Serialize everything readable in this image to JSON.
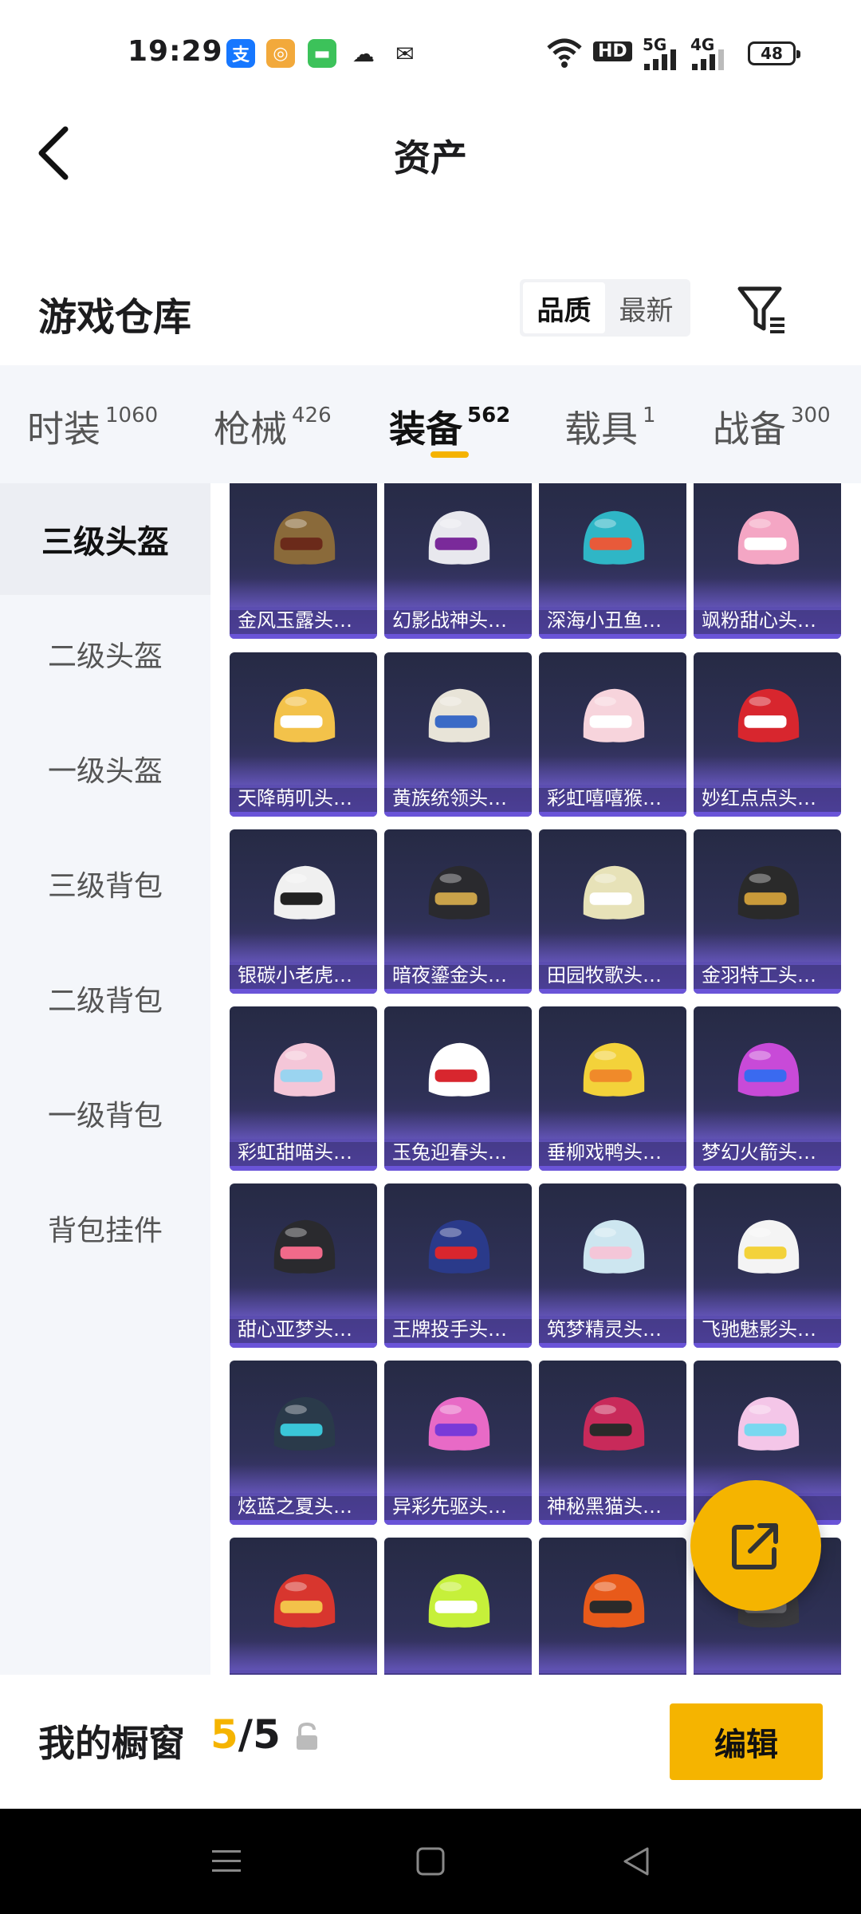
{
  "status_bar": {
    "time": "19:29",
    "battery": "48",
    "network_labels": [
      "HD",
      "5G",
      "4G"
    ]
  },
  "header": {
    "title": "资产"
  },
  "section": {
    "title": "游戏仓库",
    "sort_options": [
      "品质",
      "最新"
    ],
    "active_sort": "品质"
  },
  "tabs": [
    {
      "label": "时装",
      "count": "1060"
    },
    {
      "label": "枪械",
      "count": "426"
    },
    {
      "label": "装备",
      "count": "562"
    },
    {
      "label": "载具",
      "count": "1"
    },
    {
      "label": "战备",
      "count": "300"
    }
  ],
  "active_tab": "装备",
  "sidebar": {
    "items": [
      "三级头盔",
      "二级头盔",
      "一级头盔",
      "三级背包",
      "二级背包",
      "一级背包",
      "背包挂件"
    ],
    "active": "三级头盔"
  },
  "items": [
    {
      "label": "金风玉露头盔...",
      "colors": [
        "#8a6a3a",
        "#6b2a1a"
      ]
    },
    {
      "label": "幻影战神头盔...",
      "colors": [
        "#e8e8ee",
        "#7a2a9a"
      ]
    },
    {
      "label": "深海小丑鱼头...",
      "colors": [
        "#2fb6c6",
        "#e85a3a"
      ]
    },
    {
      "label": "飒粉甜心头盔...",
      "colors": [
        "#f4a6c4",
        "#ffffff"
      ]
    },
    {
      "label": "天降萌叽头盔...",
      "colors": [
        "#f3c24a",
        "#ffffff"
      ]
    },
    {
      "label": "黄族统领头盔...",
      "colors": [
        "#e8e4d8",
        "#3a6ac6"
      ]
    },
    {
      "label": "彩虹嘻嘻猴头...",
      "colors": [
        "#f7d4dc",
        "#ffffff"
      ]
    },
    {
      "label": "妙红点点头盔...",
      "colors": [
        "#d8262e",
        "#ffffff"
      ]
    },
    {
      "label": "银碳小老虎头...",
      "colors": [
        "#f0f0f0",
        "#222222"
      ]
    },
    {
      "label": "暗夜鎏金头盔...",
      "colors": [
        "#2a2a2e",
        "#c9a24a"
      ]
    },
    {
      "label": "田园牧歌头盔...",
      "colors": [
        "#e7e2b8",
        "#ffffff"
      ]
    },
    {
      "label": "金羽特工头盔...",
      "colors": [
        "#2a2a2a",
        "#c99a3a"
      ]
    },
    {
      "label": "彩虹甜喵头盔...",
      "colors": [
        "#f4c6d8",
        "#9ad4f0"
      ]
    },
    {
      "label": "玉兔迎春头盔...",
      "colors": [
        "#ffffff",
        "#d8262e"
      ]
    },
    {
      "label": "垂柳戏鸭头盔...",
      "colors": [
        "#f3d23a",
        "#f08a2a"
      ]
    },
    {
      "label": "梦幻火箭头盔...",
      "colors": [
        "#c84ad8",
        "#3a6af0"
      ]
    },
    {
      "label": "甜心亚梦头盔...",
      "colors": [
        "#2a2a2e",
        "#f06a8a"
      ]
    },
    {
      "label": "王牌投手头盔...",
      "colors": [
        "#2a3a8a",
        "#d8262e"
      ]
    },
    {
      "label": "筑梦精灵头盔...",
      "colors": [
        "#cde6f0",
        "#f4c6d8"
      ]
    },
    {
      "label": "飞驰魅影头盔...",
      "colors": [
        "#f4f4f4",
        "#f3d23a"
      ]
    },
    {
      "label": "炫蓝之夏头盔...",
      "colors": [
        "#2a3a4a",
        "#3ac6d8"
      ]
    },
    {
      "label": "异彩先驱头盔...",
      "colors": [
        "#e86ac6",
        "#7a3ad8"
      ]
    },
    {
      "label": "神秘黑猫头盔...",
      "colors": [
        "#c82a5a",
        "#2a2a2a"
      ]
    },
    {
      "label": "",
      "colors": [
        "#f4c6e8",
        "#7ad8f0"
      ]
    },
    {
      "label": "",
      "colors": [
        "#d8362e",
        "#f3c24a"
      ]
    },
    {
      "label": "",
      "colors": [
        "#c6f03a",
        "#ffffff"
      ]
    },
    {
      "label": "",
      "colors": [
        "#e85a1a",
        "#2a2a2a"
      ]
    },
    {
      "label": "",
      "colors": [
        "#3a3a3e",
        "#6a6a6e"
      ]
    }
  ],
  "showcase": {
    "label": "我的橱窗",
    "current": "5",
    "separator": "/",
    "total": "5"
  },
  "edit_button": "编辑",
  "accent_color": "#f5b400"
}
